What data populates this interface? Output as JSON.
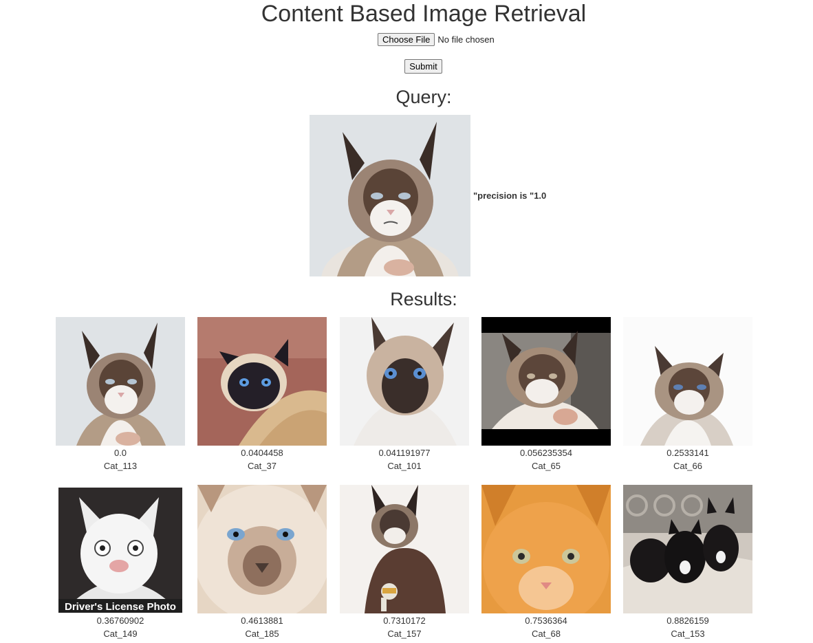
{
  "page": {
    "title": "Content Based Image Retrieval"
  },
  "upload": {
    "choose_label": "Choose File",
    "status_text": "No file chosen",
    "submit_label": "Submit"
  },
  "query": {
    "heading": "Query:",
    "precision_text": "\"precision is \"1.0"
  },
  "results": {
    "heading": "Results:",
    "items": [
      {
        "score": "0.0",
        "name": "Cat_113"
      },
      {
        "score": "0.0404458",
        "name": "Cat_37"
      },
      {
        "score": "0.041191977",
        "name": "Cat_101"
      },
      {
        "score": "0.056235354",
        "name": "Cat_65"
      },
      {
        "score": "0.2533141",
        "name": "Cat_66"
      },
      {
        "score": "0.36760902",
        "name": "Cat_149"
      },
      {
        "score": "0.4613881",
        "name": "Cat_185"
      },
      {
        "score": "0.7310172",
        "name": "Cat_157"
      },
      {
        "score": "0.7536364",
        "name": "Cat_68"
      },
      {
        "score": "0.8826159",
        "name": "Cat_153"
      }
    ],
    "overlay_caption": "Driver's License Photo"
  }
}
